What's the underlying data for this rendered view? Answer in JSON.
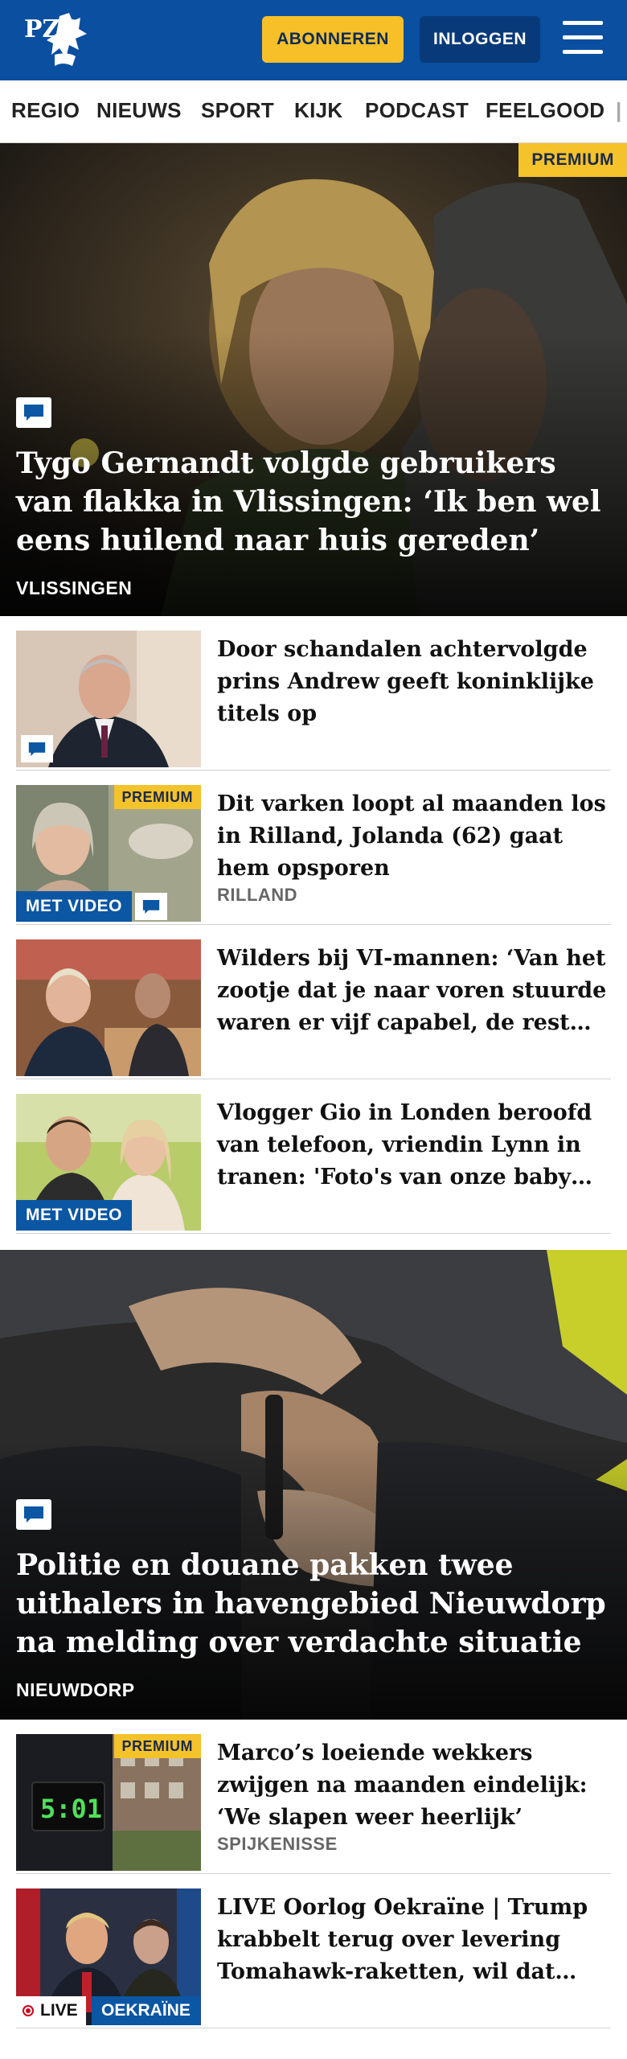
{
  "header": {
    "logo_text": "PZC",
    "subscribe_label": "ABONNEREN",
    "login_label": "INLOGGEN",
    "brand_color": "#0a4fa0",
    "accent_color": "#f7c028"
  },
  "nav": {
    "items": [
      "REGIO",
      "NIEUWS",
      "SPORT",
      "KIJK",
      "PODCAST",
      "FEELGOOD"
    ]
  },
  "hero1": {
    "badge": "PREMIUM",
    "title": "Tygo Gernandt volgde gebruikers van flakka in Vlissingen: ‘Ik ben wel eens huilend naar huis gereden’",
    "tag": "VLISSINGEN",
    "icon": "comment-icon"
  },
  "articles1": [
    {
      "title": "Door schandalen achtervolgde prins Andrew geeft koninklijke titels op",
      "tag": ""
    },
    {
      "title": "Dit varken loopt al maanden los in Rilland, Jolanda (62) gaat hem opsporen",
      "tag": "RILLAND",
      "premium": "PREMIUM",
      "video": "MET VIDEO"
    },
    {
      "title": "Wilders bij VI-mannen: ‘Van het zootje dat je naar voren stuurde waren er vijf capabel, de rest…",
      "tag": ""
    },
    {
      "title": "Vlogger Gio in Londen beroofd van telefoon, vriendin Lynn in tranen: 'Foto's van onze baby…",
      "tag": "",
      "video": "MET VIDEO"
    }
  ],
  "hero2": {
    "title": "Politie en douane pakken twee uithalers in havengebied Nieuwdorp na melding over verdachte situatie",
    "tag": "NIEUWDORP",
    "icon": "comment-icon"
  },
  "articles2": [
    {
      "title": "Marco’s loeiende wekkers zwijgen na maanden eindelijk: ‘We slapen weer heerlijk’",
      "tag": "SPIJKENISSE",
      "premium": "PREMIUM",
      "clock": "5:01"
    },
    {
      "title": "LIVE Oorlog Oekraïne | Trump krabbelt terug over levering Tomahawk-raketten, wil dat…",
      "tag": "",
      "live": "LIVE",
      "topic": "OEKRAÏNE"
    }
  ]
}
